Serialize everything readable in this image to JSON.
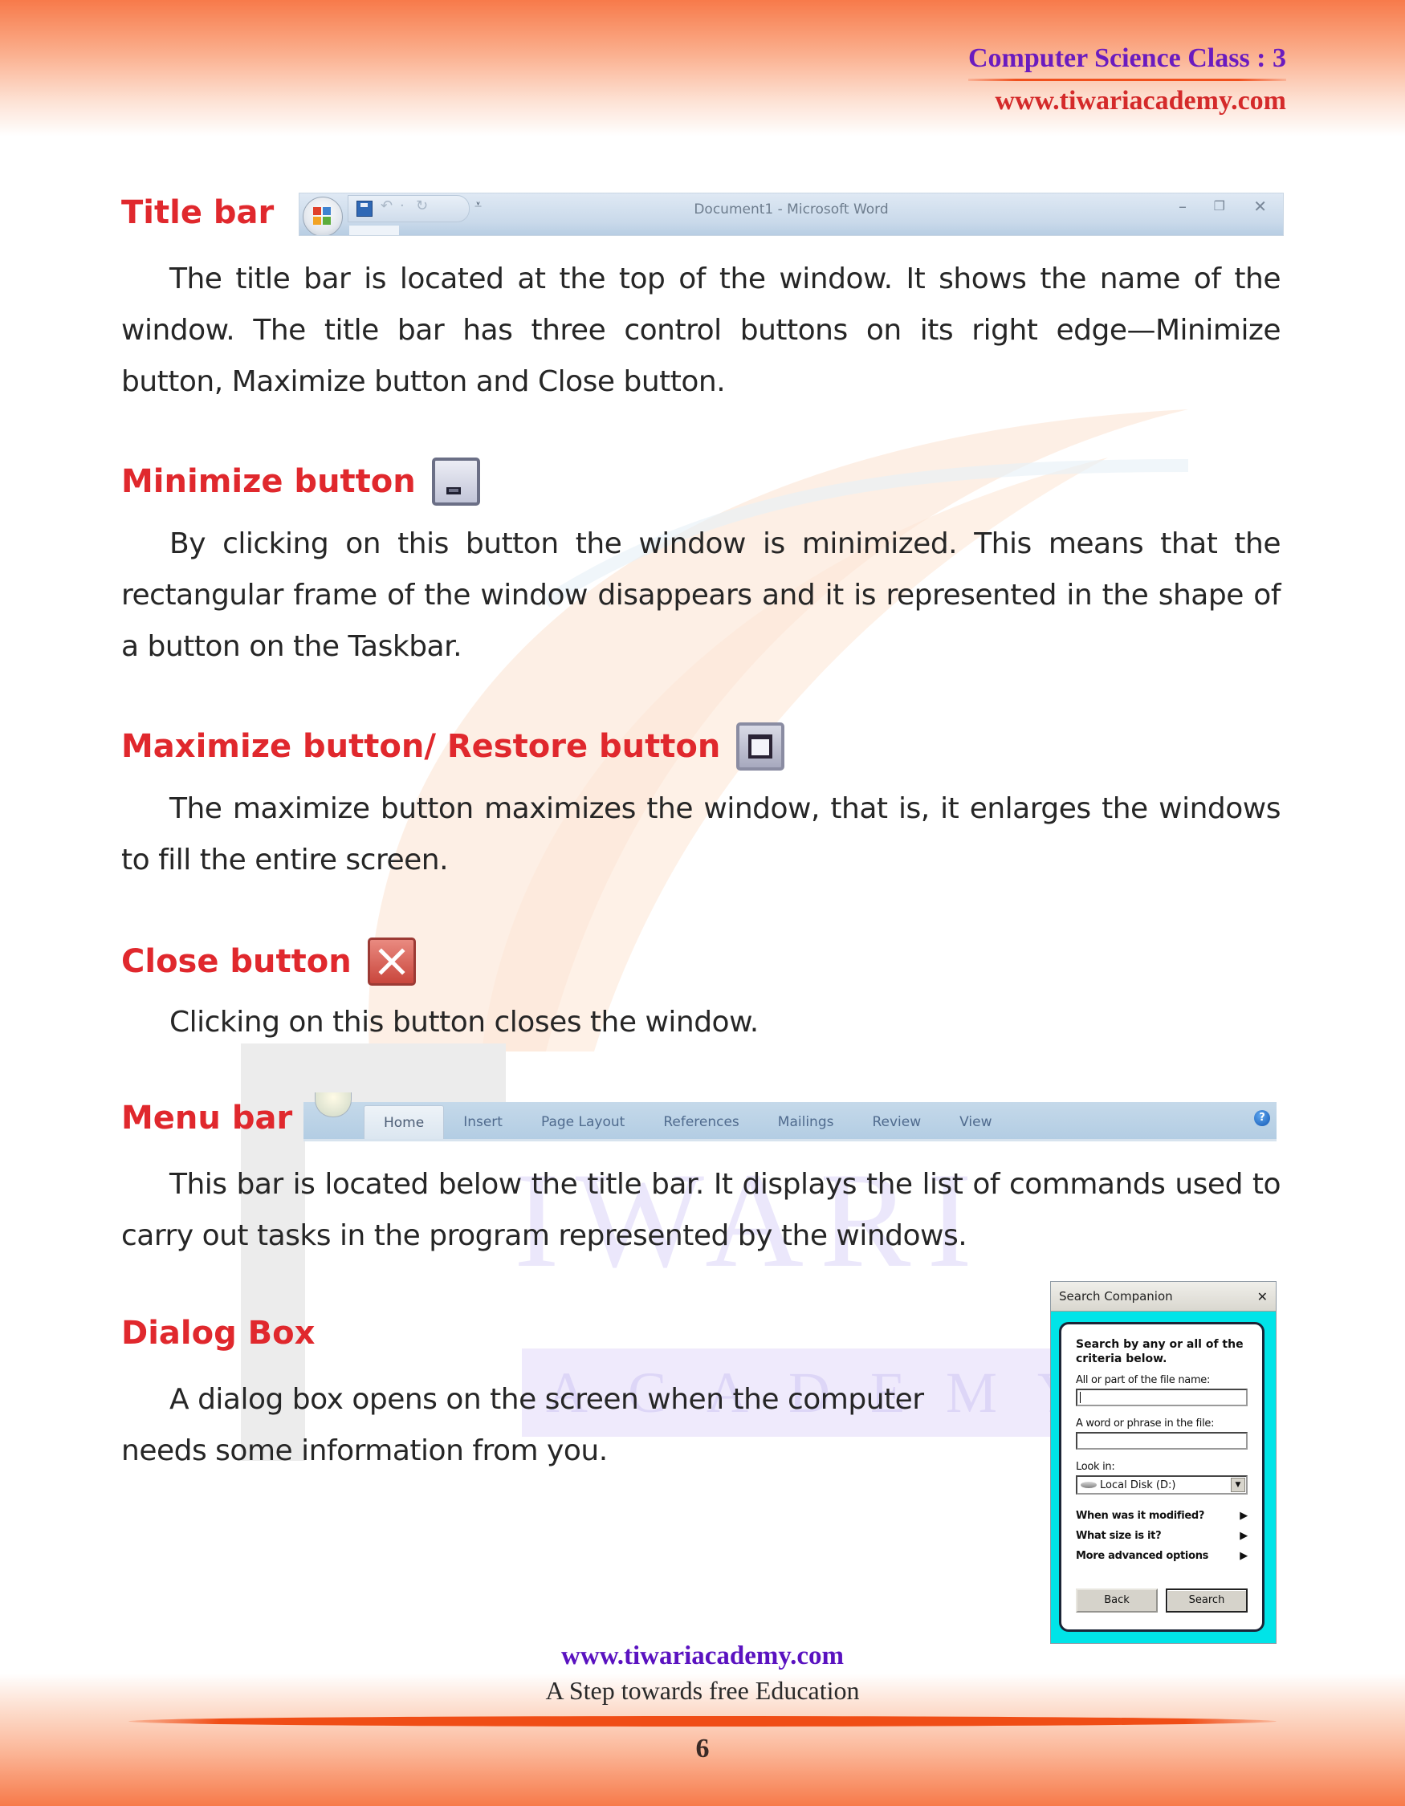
{
  "header": {
    "class_label": "Computer Science Class : 3",
    "website": "www.tiwariacademy.com"
  },
  "watermark": {
    "word": "IWARI",
    "sub": "ACADEMY"
  },
  "sections": {
    "title_bar": {
      "heading": "Title bar",
      "text": "The title bar is located at the top of the window. It shows the name of the window. The title bar has three control buttons on its right edge—Minimize button, Maximize button and Close button.",
      "screenshot": {
        "window_title": "Document1 - Microsoft Word",
        "minimize_glyph": "–",
        "restore_glyph": "❐",
        "close_glyph": "✕",
        "qat_undo_glyph": "↶",
        "qat_sep_glyph": "·",
        "qat_redo_glyph": "↻",
        "qat_more_glyph": "⩡"
      }
    },
    "minimize": {
      "heading": "Minimize button",
      "text": "By clicking on this button the window is minimized. This means that the rectangular frame of the window disappears and it is represented in the shape of a button on the Taskbar."
    },
    "maximize": {
      "heading": "Maximize button/ Restore button",
      "text": "The maximize button maximizes the window, that is, it enlarges the windows to fill the entire screen."
    },
    "close": {
      "heading": "Close button",
      "text": "Clicking on this button closes the window."
    },
    "menu_bar": {
      "heading": "Menu bar",
      "text": "This bar is located below the title bar. It displays the list of commands used to carry out tasks in the program represented by the windows.",
      "tabs": [
        "Home",
        "Insert",
        "Page Layout",
        "References",
        "Mailings",
        "Review",
        "View"
      ],
      "help_glyph": "?"
    },
    "dialog_box": {
      "heading": "Dialog Box",
      "text": "A dialog box opens on the screen when the computer needs some information from you."
    }
  },
  "dialog": {
    "title": "Search Companion",
    "close_glyph": "✕",
    "heading": "Search by any or all of the criteria below.",
    "file_name_label": "All or part of the file name:",
    "file_name_value": "",
    "phrase_label": "A word or phrase in the file:",
    "phrase_value": "",
    "look_in_label": "Look in:",
    "look_in_value": "Local Disk (D:)",
    "dropdown_glyph": "▼",
    "options": [
      {
        "label": "When was it modified?",
        "arrow": "▶"
      },
      {
        "label": "What size is it?",
        "arrow": "▶"
      },
      {
        "label": "More advanced options",
        "arrow": "▶"
      }
    ],
    "back_label": "Back",
    "search_label": "Search"
  },
  "footer": {
    "website": "www.tiwariacademy.com",
    "tagline": "A Step towards free Education",
    "page_number": "6"
  }
}
